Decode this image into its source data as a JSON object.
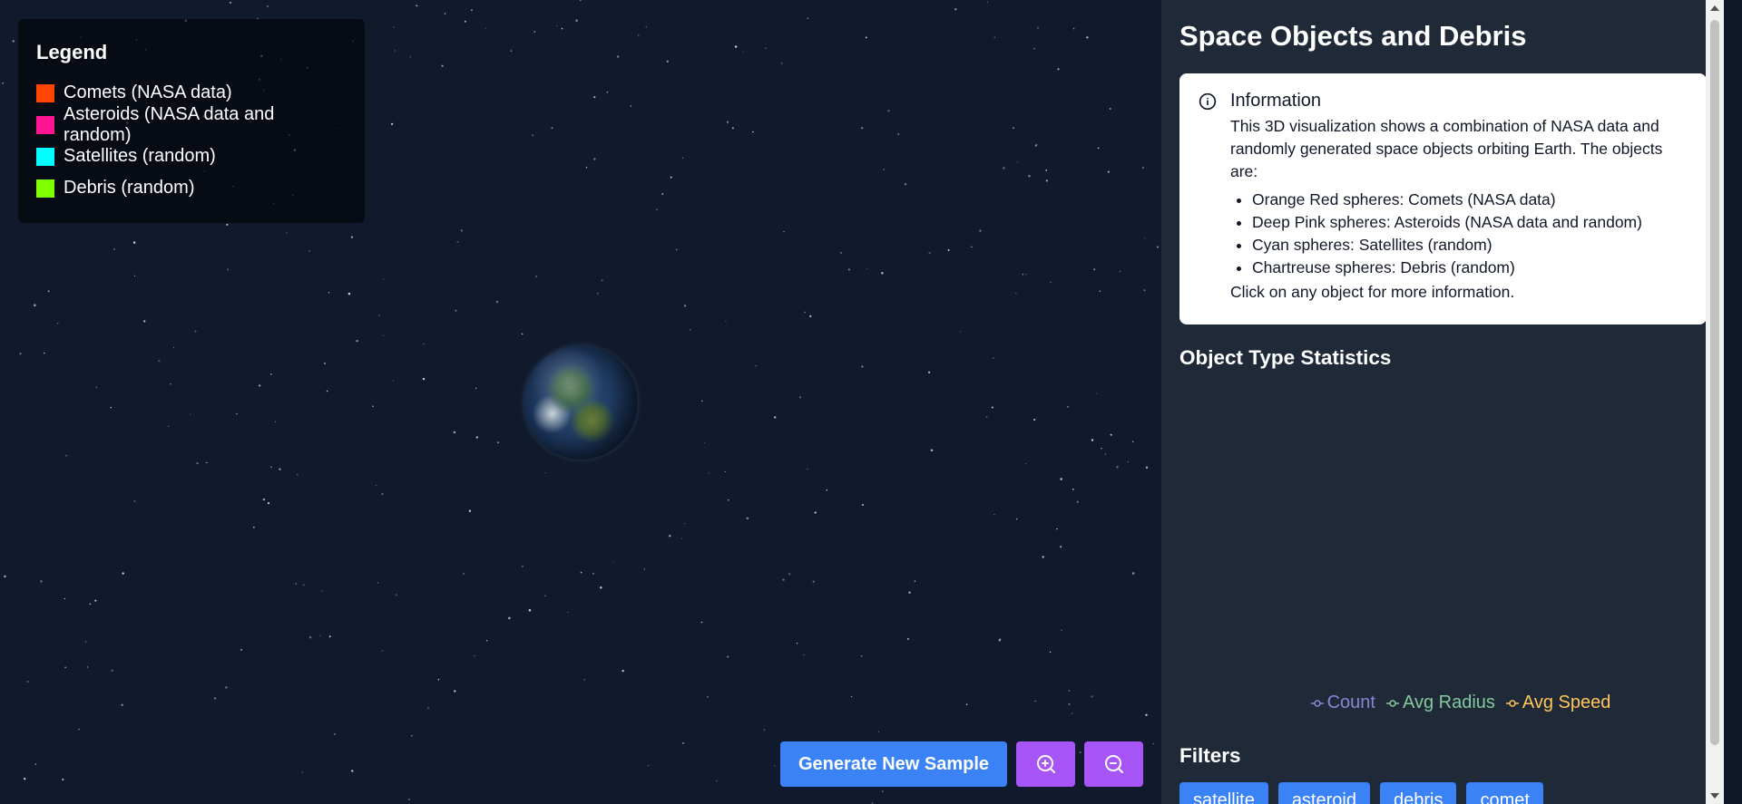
{
  "legend": {
    "title": "Legend",
    "items": [
      {
        "label": "Comets (NASA data)",
        "color": "#ff4500"
      },
      {
        "label": "Asteroids (NASA data and random)",
        "color": "#ff1493"
      },
      {
        "label": "Satellites (random)",
        "color": "#00ffff"
      },
      {
        "label": "Debris (random)",
        "color": "#7fff00"
      }
    ]
  },
  "controls": {
    "generate_label": "Generate New Sample",
    "zoom_in_icon": "zoom-in-icon",
    "zoom_out_icon": "zoom-out-icon"
  },
  "panel": {
    "title": "Space Objects and Debris",
    "info": {
      "title": "Information",
      "intro": "This 3D visualization shows a combination of NASA data and randomly generated space objects orbiting Earth. The objects are:",
      "items": [
        "Orange Red spheres: Comets (NASA data)",
        "Deep Pink spheres: Asteroids (NASA data and random)",
        "Cyan spheres: Satellites (random)",
        "Chartreuse spheres: Debris (random)"
      ],
      "footer": "Click on any object for more information."
    },
    "stats_title": "Object Type Statistics",
    "chart_legend": [
      {
        "label": "Count",
        "color": "#8884d8"
      },
      {
        "label": "Avg Radius",
        "color": "#82ca9d"
      },
      {
        "label": "Avg Speed",
        "color": "#ffc658"
      }
    ],
    "filters_title": "Filters",
    "filters": [
      "satellite",
      "asteroid",
      "debris",
      "comet"
    ]
  },
  "colors": {
    "space_bg": "#111a2d",
    "panel_bg": "#1f2937",
    "button_blue": "#3b82f6",
    "button_purple": "#a855f7"
  }
}
